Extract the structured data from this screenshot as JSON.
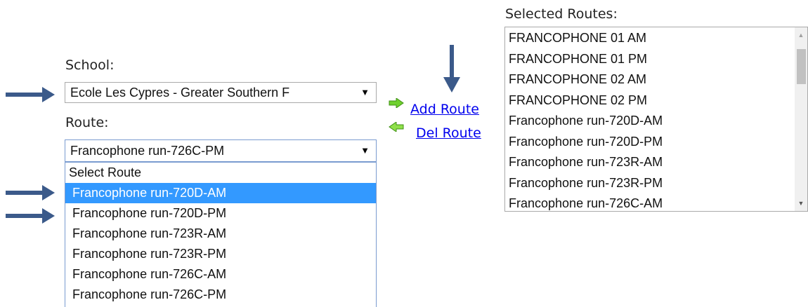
{
  "school": {
    "label": "School:",
    "selected": "Ecole Les Cypres - Greater Southern F"
  },
  "route": {
    "label": "Route:",
    "selected": "Francophone run-726C-PM",
    "options": [
      "Select Route",
      "Francophone run-720D-AM",
      "Francophone run-720D-PM",
      "Francophone run-723R-AM",
      "Francophone run-723R-PM",
      "Francophone run-726C-AM",
      "Francophone run-726C-PM"
    ],
    "highlighted_index": 1
  },
  "actions": {
    "add_label": "Add Route",
    "del_label": "Del Route"
  },
  "selected_routes": {
    "label": "Selected Routes:",
    "items": [
      "FRANCOPHONE 01 AM",
      "FRANCOPHONE 01 PM",
      "FRANCOPHONE 02 AM",
      "FRANCOPHONE 02 PM",
      "Francophone run-720D-AM",
      "Francophone run-720D-PM",
      "Francophone run-723R-AM",
      "Francophone run-723R-PM",
      "Francophone run-726C-AM"
    ]
  },
  "icons": {
    "add": "arrow-right-icon",
    "del": "arrow-left-icon",
    "annotation": "annotation-arrow-icon"
  },
  "colors": {
    "annotation_arrow": "#3b5a8a",
    "highlight": "#3399ff",
    "link": "#0000ee",
    "add_arrow": "#5fc22a",
    "del_arrow": "#5fc22a"
  }
}
